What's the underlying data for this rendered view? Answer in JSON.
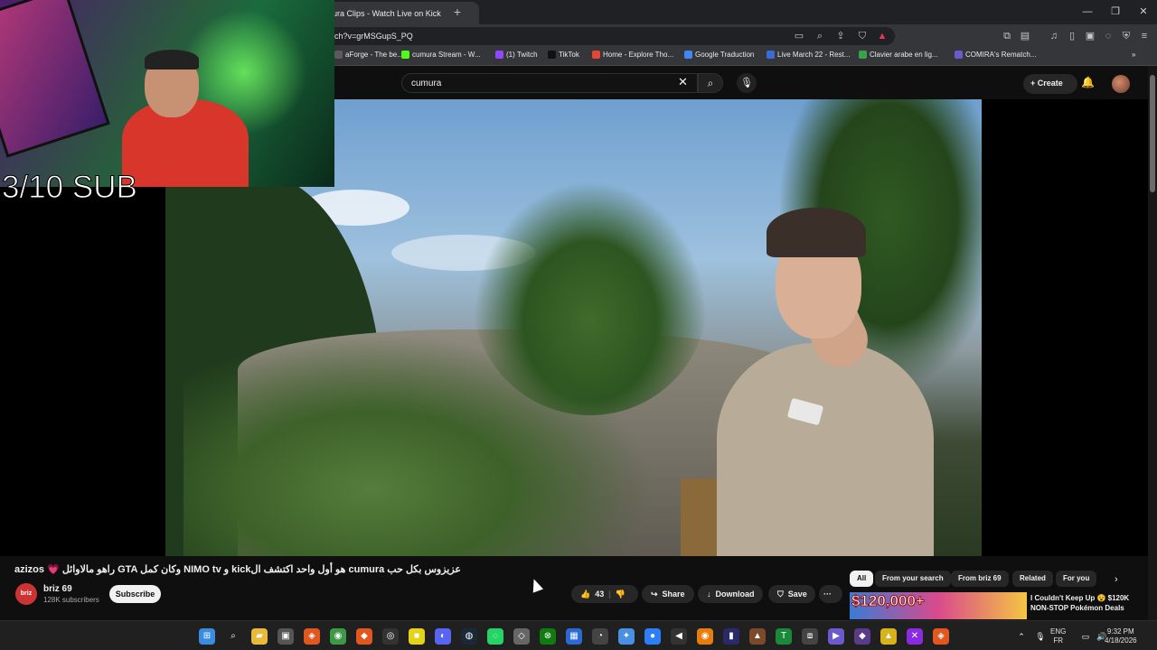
{
  "browser": {
    "tab_title": "ura Clips - Watch Live on Kick",
    "new_tab": "+",
    "url": "ch?v=grMSGupS_PQ",
    "window_controls": {
      "minimize": "—",
      "maximize": "❐",
      "close": "✕"
    },
    "bookmarks": [
      {
        "label": "aForge - The be...",
        "color": "#5a5a5a"
      },
      {
        "label": "cumura Stream - W...",
        "color": "#53fc18"
      },
      {
        "label": "(1) Twitch",
        "color": "#9146ff"
      },
      {
        "label": "TikTok",
        "color": "#111111"
      },
      {
        "label": "Home - Explore Tho...",
        "color": "#e6452f"
      },
      {
        "label": "Google Traduction",
        "color": "#4285f4"
      },
      {
        "label": "Live March 22 - Rest...",
        "color": "#3b6bd6"
      },
      {
        "label": "Clavier arabe en lig...",
        "color": "#3aa34a"
      },
      {
        "label": "COMIRA's Rematch...",
        "color": "#6a5acd"
      }
    ],
    "bookmarks_overflow": "»"
  },
  "youtube": {
    "search_value": "cumura",
    "create_label": "Create",
    "video": {
      "title": "azizos 💗 راهو مالاوائل GTA وكان كمل NIMO tv و kickهو أول واحد اكتشف ال cumura عزيزوس بكل حب",
      "channel_name": "briz 69",
      "channel_avatar_text": "briz",
      "subscribers": "128K subscribers",
      "subscribe_label": "Subscribe",
      "like_count": "43",
      "share_label": "Share",
      "download_label": "Download",
      "save_label": "Save",
      "more_label": "···"
    },
    "chips": [
      "All",
      "From your search",
      "From briz 69",
      "Related",
      "For you"
    ],
    "recommendation": {
      "thumb_text": "$120,000+",
      "title": "I Couldn't Keep Up 😵 $120K NON-STOP Pokémon Deals"
    }
  },
  "overlay": {
    "label": "3/10 SUB"
  },
  "taskbar": {
    "lang_line1": "ENG",
    "lang_line2": "FR",
    "time": "9:32 PM",
    "date": "4/18/2026"
  }
}
